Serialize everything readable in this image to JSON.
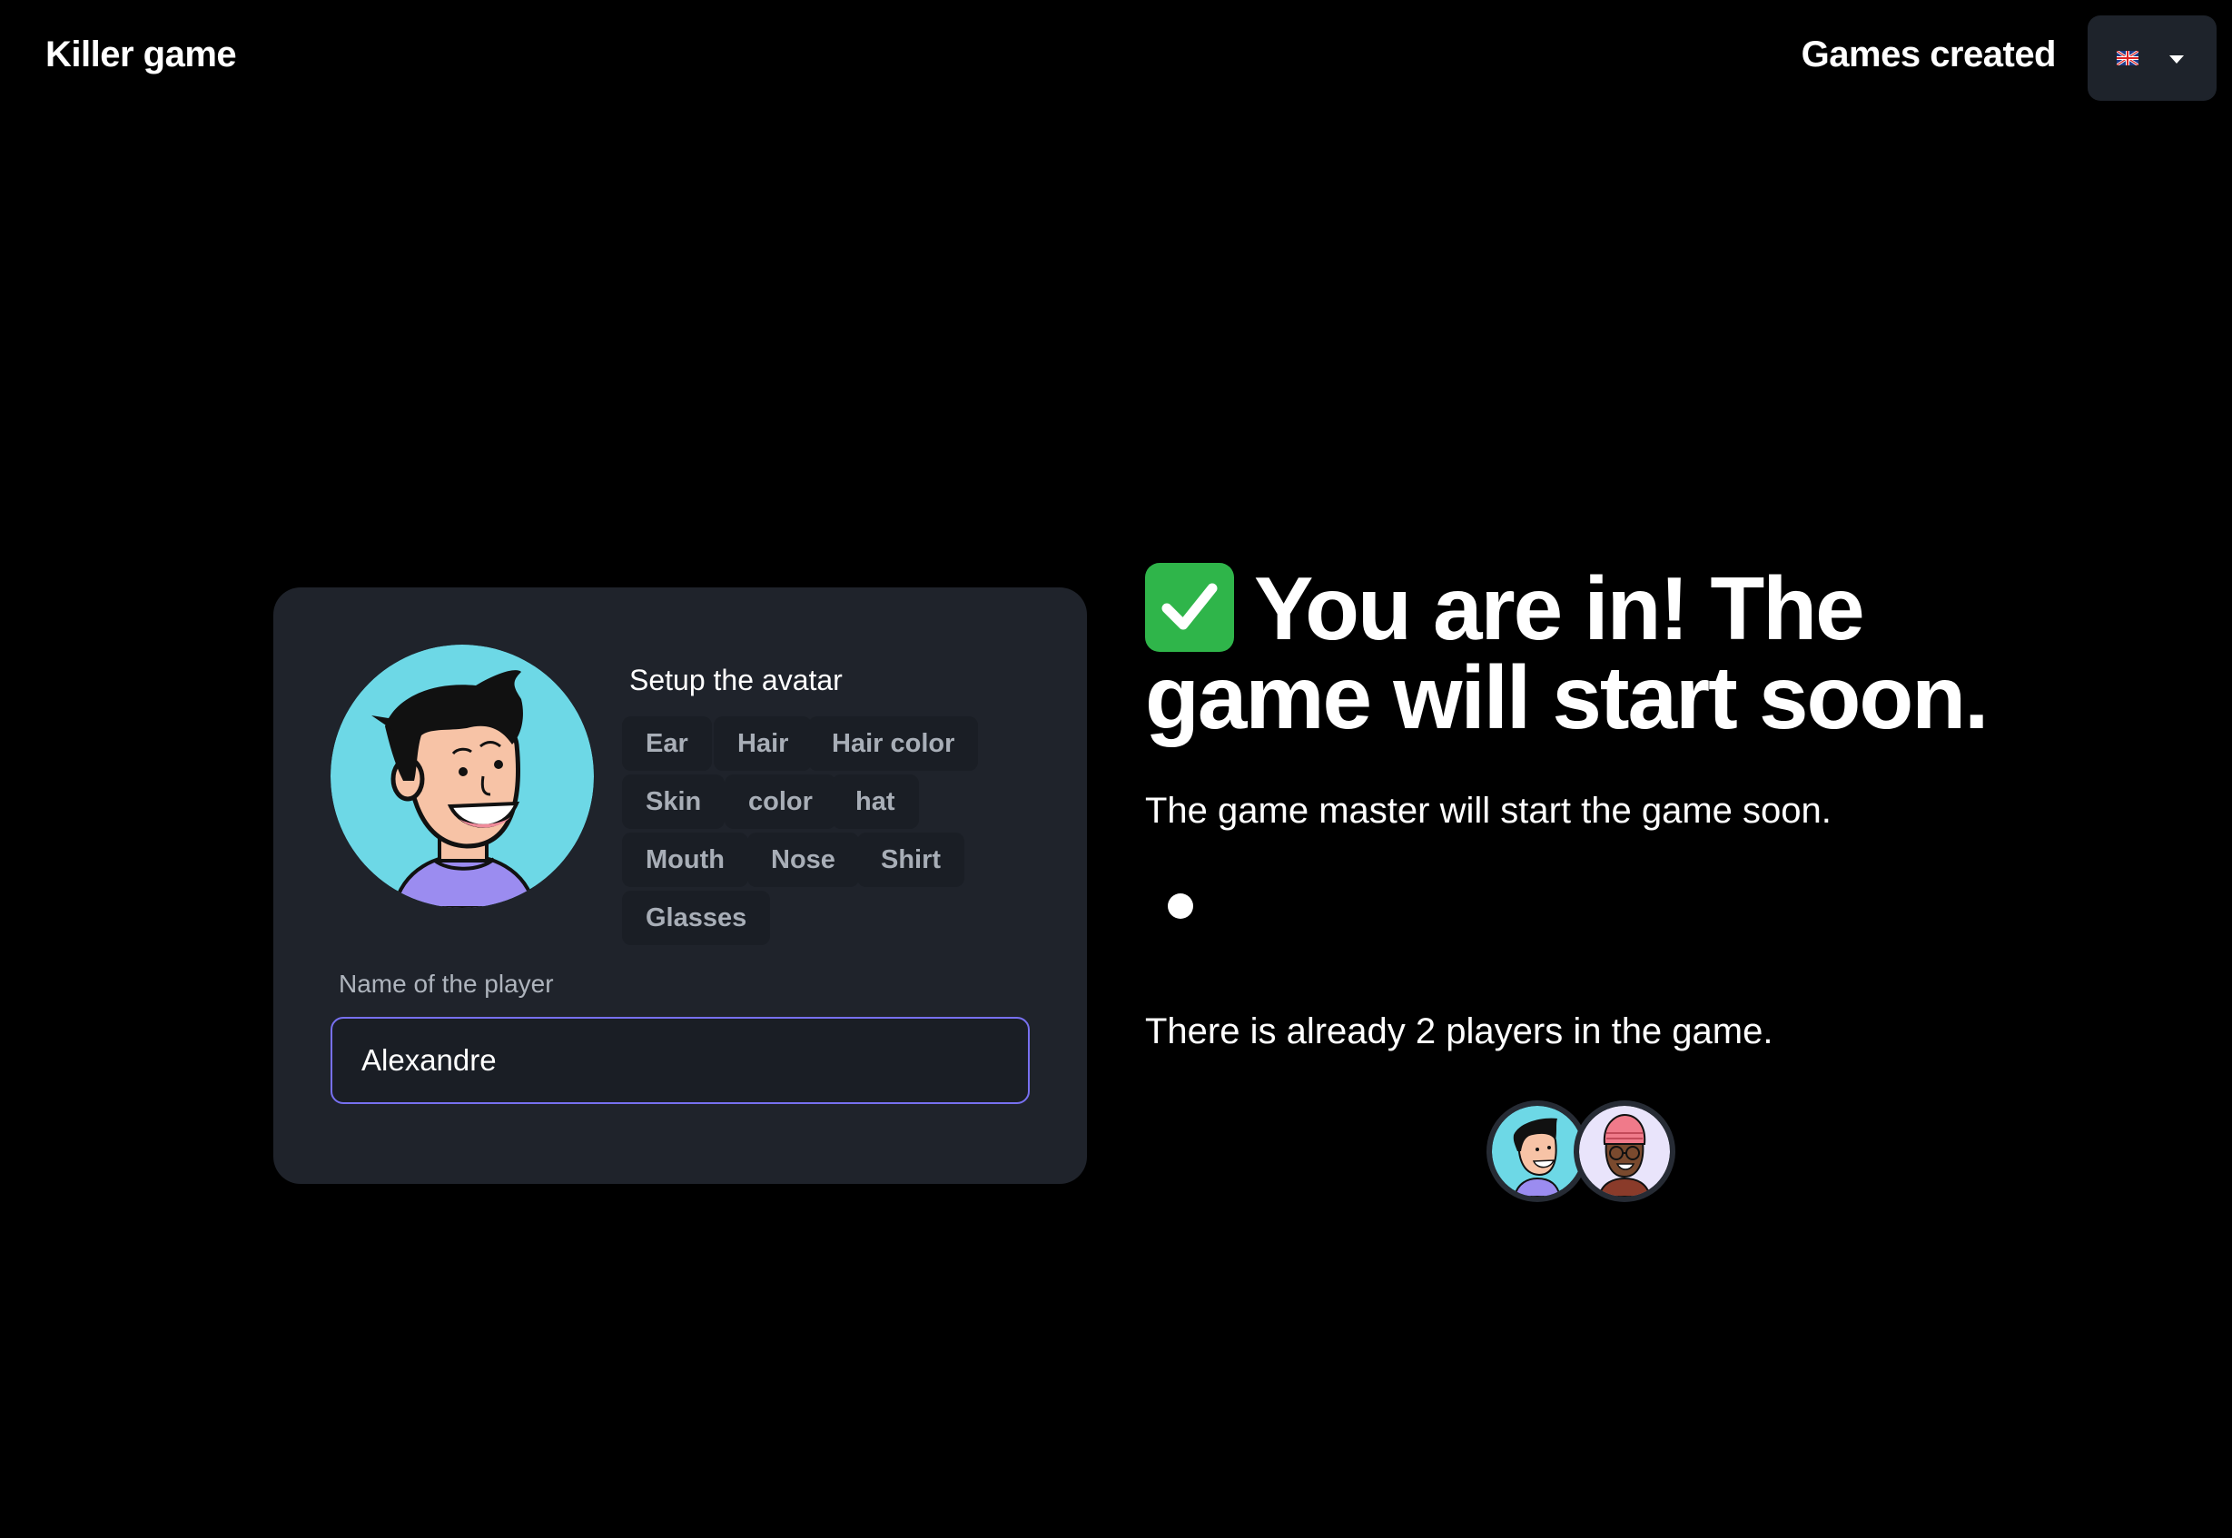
{
  "navbar": {
    "brand": "Killer game",
    "games_link": "Games created",
    "language": {
      "flag": "uk-flag-icon"
    }
  },
  "avatar_editor": {
    "title": "Setup the avatar",
    "options": [
      "Ear",
      "Hair",
      "Hair color",
      "Skin",
      "color",
      "hat",
      "Mouth",
      "Nose",
      "Shirt",
      "Glasses"
    ],
    "avatar_bg": "#6dd8e6",
    "shirt_color": "#9b8cf0"
  },
  "player_name": {
    "label": "Name of the player",
    "value": "Alexandre"
  },
  "status": {
    "headline": "You are in! The game will start soon.",
    "subtitle": "The game master will start the game soon.",
    "players_text": "There is already 2 players in the game."
  },
  "players": [
    {
      "avatar": "boy-avatar",
      "bg": "#6dd8e6"
    },
    {
      "avatar": "girl-beanie-avatar",
      "bg": "#e9e4fb"
    }
  ],
  "colors": {
    "background": "#000000",
    "card": "#1f232b",
    "accent_border": "#7770f0",
    "check_green": "#2fb54a"
  }
}
